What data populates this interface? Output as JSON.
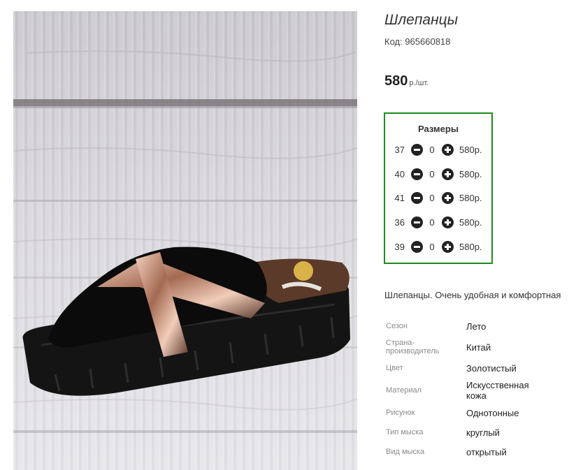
{
  "product": {
    "title": "Шлепанцы",
    "sku": "Код: 965660818",
    "price": "580",
    "price_unit": "р./шт.",
    "description": "Шлепанцы. Очень удобная и комфортная"
  },
  "sizes": {
    "title": "Размеры",
    "rows": [
      {
        "size": "37",
        "qty": "0",
        "price": "580р."
      },
      {
        "size": "40",
        "qty": "0",
        "price": "580р."
      },
      {
        "size": "41",
        "qty": "0",
        "price": "580р."
      },
      {
        "size": "36",
        "qty": "0",
        "price": "580р."
      },
      {
        "size": "39",
        "qty": "0",
        "price": "580р."
      }
    ]
  },
  "specs": [
    {
      "label": "Сезон",
      "value": "Лето"
    },
    {
      "label": "Страна-\nпроизводитель",
      "value": "Китай"
    },
    {
      "label": "Цвет",
      "value": "Золотистый"
    },
    {
      "label": "Материал",
      "value": "Искусственная\nкожа"
    },
    {
      "label": "Рисунок",
      "value": "Однотонные"
    },
    {
      "label": "Тип мыска",
      "value": "круглый"
    },
    {
      "label": "Вид мыска",
      "value": "открытый"
    }
  ],
  "colors": {
    "accent_border": "#1e8a1e",
    "button_fill": "#222222"
  },
  "icons": {
    "minus": "minus-circle-icon",
    "plus": "plus-circle-icon"
  }
}
